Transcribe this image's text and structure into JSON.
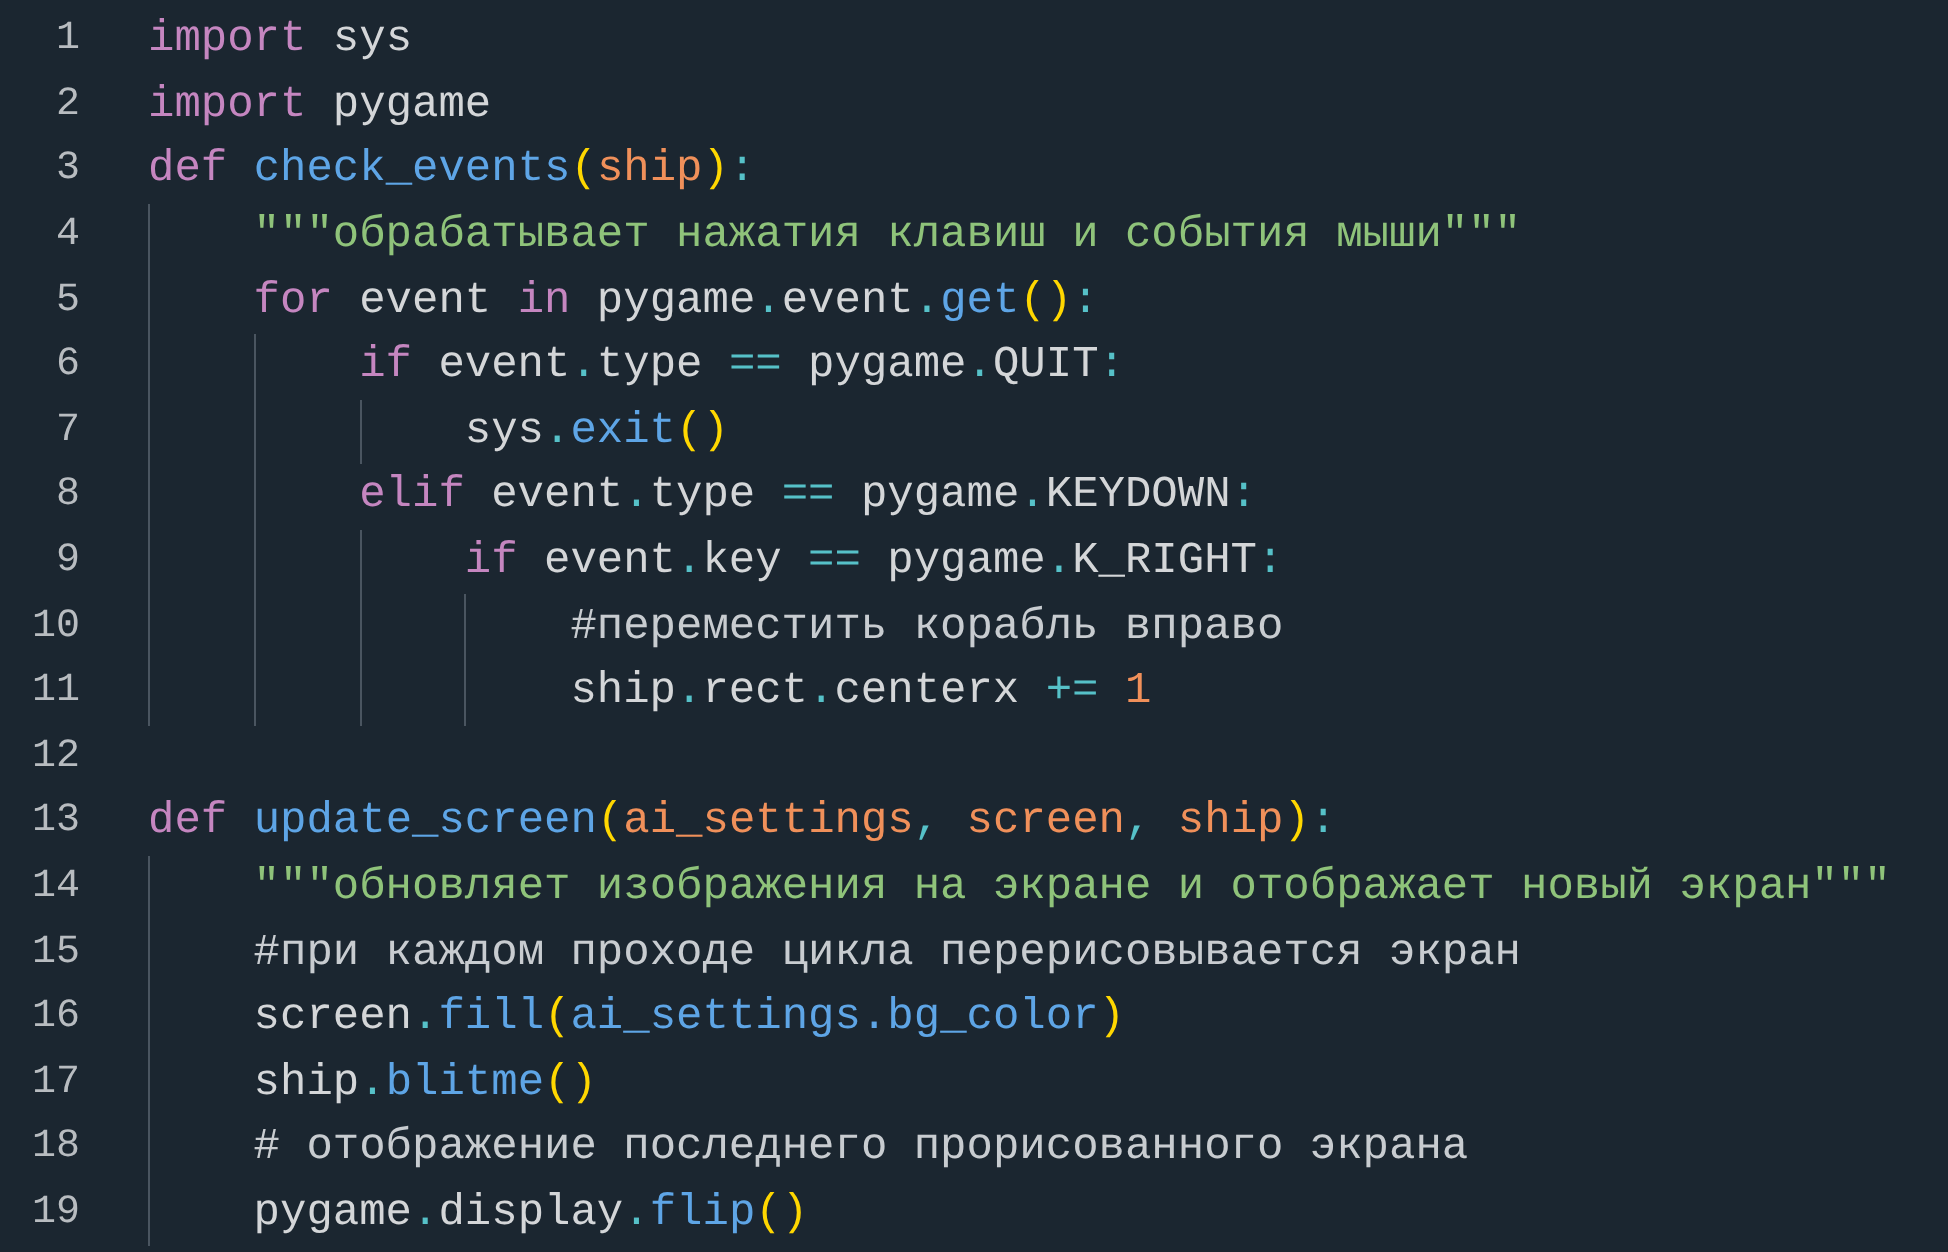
{
  "editor": {
    "lines": [
      {
        "number": "1",
        "tokens": [
          {
            "kind": "kw",
            "text": "import"
          },
          {
            "kind": "plain",
            "text": " sys"
          }
        ]
      },
      {
        "number": "2",
        "tokens": [
          {
            "kind": "kw",
            "text": "import"
          },
          {
            "kind": "plain",
            "text": " pygame"
          }
        ]
      },
      {
        "number": "3",
        "tokens": [
          {
            "kind": "kw",
            "text": "def "
          },
          {
            "kind": "fn",
            "text": "check_events"
          },
          {
            "kind": "bracket",
            "text": "("
          },
          {
            "kind": "param",
            "text": "ship"
          },
          {
            "kind": "bracket",
            "text": ")"
          },
          {
            "kind": "op",
            "text": ":"
          }
        ],
        "children": [
          {
            "number": "4",
            "tokens": [
              {
                "kind": "str",
                "text": "\"\"\"обрабатывает нажатия клавиш и события мыши\"\"\""
              }
            ]
          },
          {
            "number": "5",
            "tokens": [
              {
                "kind": "kw",
                "text": "for"
              },
              {
                "kind": "plain",
                "text": " event "
              },
              {
                "kind": "kw",
                "text": "in"
              },
              {
                "kind": "plain",
                "text": " pygame"
              },
              {
                "kind": "op",
                "text": "."
              },
              {
                "kind": "plain",
                "text": "event"
              },
              {
                "kind": "op",
                "text": "."
              },
              {
                "kind": "fn",
                "text": "get"
              },
              {
                "kind": "bracket",
                "text": "()"
              },
              {
                "kind": "op",
                "text": ":"
              }
            ],
            "children": [
              {
                "number": "6",
                "tokens": [
                  {
                    "kind": "kw",
                    "text": "if"
                  },
                  {
                    "kind": "plain",
                    "text": " event"
                  },
                  {
                    "kind": "op",
                    "text": "."
                  },
                  {
                    "kind": "plain",
                    "text": "type "
                  },
                  {
                    "kind": "op",
                    "text": "=="
                  },
                  {
                    "kind": "plain",
                    "text": " pygame"
                  },
                  {
                    "kind": "op",
                    "text": "."
                  },
                  {
                    "kind": "plain",
                    "text": "QUIT"
                  },
                  {
                    "kind": "op",
                    "text": ":"
                  }
                ],
                "children": [
                  {
                    "number": "7",
                    "tokens": [
                      {
                        "kind": "plain",
                        "text": "sys"
                      },
                      {
                        "kind": "op",
                        "text": "."
                      },
                      {
                        "kind": "fn",
                        "text": "exit"
                      },
                      {
                        "kind": "bracket",
                        "text": "()"
                      }
                    ]
                  }
                ]
              },
              {
                "number": "8",
                "tokens": [
                  {
                    "kind": "kw",
                    "text": "elif"
                  },
                  {
                    "kind": "plain",
                    "text": " event"
                  },
                  {
                    "kind": "op",
                    "text": "."
                  },
                  {
                    "kind": "plain",
                    "text": "type "
                  },
                  {
                    "kind": "op",
                    "text": "=="
                  },
                  {
                    "kind": "plain",
                    "text": " pygame"
                  },
                  {
                    "kind": "op",
                    "text": "."
                  },
                  {
                    "kind": "plain",
                    "text": "KEYDOWN"
                  },
                  {
                    "kind": "op",
                    "text": ":"
                  }
                ],
                "children": [
                  {
                    "number": "9",
                    "tokens": [
                      {
                        "kind": "kw",
                        "text": "if"
                      },
                      {
                        "kind": "plain",
                        "text": " event"
                      },
                      {
                        "kind": "op",
                        "text": "."
                      },
                      {
                        "kind": "plain",
                        "text": "key "
                      },
                      {
                        "kind": "op",
                        "text": "=="
                      },
                      {
                        "kind": "plain",
                        "text": " pygame"
                      },
                      {
                        "kind": "op",
                        "text": "."
                      },
                      {
                        "kind": "plain",
                        "text": "K_RIGHT"
                      },
                      {
                        "kind": "op",
                        "text": ":"
                      }
                    ],
                    "children": [
                      {
                        "number": "10",
                        "tokens": [
                          {
                            "kind": "comment",
                            "text": "#переместить корабль вправо"
                          }
                        ]
                      },
                      {
                        "number": "11",
                        "tokens": [
                          {
                            "kind": "plain",
                            "text": "ship"
                          },
                          {
                            "kind": "op",
                            "text": "."
                          },
                          {
                            "kind": "plain",
                            "text": "rect"
                          },
                          {
                            "kind": "op",
                            "text": "."
                          },
                          {
                            "kind": "plain",
                            "text": "centerx "
                          },
                          {
                            "kind": "op",
                            "text": "+= "
                          },
                          {
                            "kind": "num",
                            "text": "1"
                          }
                        ]
                      }
                    ]
                  }
                ]
              }
            ]
          }
        ]
      },
      {
        "number": "12"
      },
      {
        "number": "13",
        "tokens": [
          {
            "kind": "kw",
            "text": "def "
          },
          {
            "kind": "fn",
            "text": "update_screen"
          },
          {
            "kind": "bracket",
            "text": "("
          },
          {
            "kind": "param",
            "text": "ai_settings"
          },
          {
            "kind": "op",
            "text": ", "
          },
          {
            "kind": "param",
            "text": "screen"
          },
          {
            "kind": "op",
            "text": ", "
          },
          {
            "kind": "param",
            "text": "ship"
          },
          {
            "kind": "bracket",
            "text": ")"
          },
          {
            "kind": "op",
            "text": ":"
          }
        ],
        "children": [
          {
            "number": "14",
            "tokens": [
              {
                "kind": "str",
                "text": "\"\"\"обновляет изображения на экране и отображает новый экран\"\"\""
              }
            ]
          },
          {
            "number": "15",
            "tokens": [
              {
                "kind": "comment",
                "text": "#при каждом проходе цикла перерисовывается экран"
              }
            ]
          },
          {
            "number": "16",
            "tokens": [
              {
                "kind": "plain",
                "text": "screen"
              },
              {
                "kind": "op",
                "text": "."
              },
              {
                "kind": "fn",
                "text": "fill"
              },
              {
                "kind": "bracket",
                "text": "("
              },
              {
                "kind": "fn",
                "text": "ai_settings.bg_color"
              },
              {
                "kind": "bracket",
                "text": ")"
              }
            ]
          },
          {
            "number": "17",
            "tokens": [
              {
                "kind": "plain",
                "text": "ship"
              },
              {
                "kind": "op",
                "text": "."
              },
              {
                "kind": "fn",
                "text": "blitme"
              },
              {
                "kind": "bracket",
                "text": "()"
              }
            ]
          },
          {
            "number": "18",
            "tokens": [
              {
                "kind": "comment",
                "text": "# отображение последнего прорисованного экрана"
              }
            ]
          },
          {
            "number": "19",
            "tokens": [
              {
                "kind": "plain",
                "text": "pygame"
              },
              {
                "kind": "op",
                "text": "."
              },
              {
                "kind": "plain",
                "text": "display"
              },
              {
                "kind": "op",
                "text": "."
              },
              {
                "kind": "fn",
                "text": "flip"
              },
              {
                "kind": "bracket",
                "text": "()"
              }
            ]
          }
        ]
      }
    ]
  }
}
